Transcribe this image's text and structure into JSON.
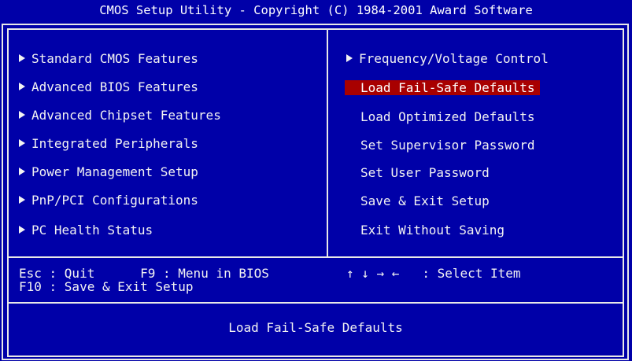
{
  "title": "CMOS Setup Utility - Copyright (C) 1984-2001 Award Software",
  "left_menu": [
    {
      "label": "Standard CMOS Features"
    },
    {
      "label": "Advanced BIOS Features"
    },
    {
      "label": "Advanced Chipset Features"
    },
    {
      "label": "Integrated Peripherals"
    },
    {
      "label": "Power Management Setup"
    },
    {
      "label": "PnP/PCI Configurations"
    },
    {
      "label": "PC Health Status"
    }
  ],
  "right_menu": [
    {
      "label": "Frequency/Voltage Control"
    },
    {
      "label": "Load Fail-Safe Defaults"
    },
    {
      "label": "Load Optimized Defaults"
    },
    {
      "label": "Set Supervisor Password"
    },
    {
      "label": "Set User Password"
    },
    {
      "label": "Save & Exit Setup"
    },
    {
      "label": "Exit Without Saving"
    }
  ],
  "help": {
    "line1_left": "Esc : Quit      F9 : Menu in BIOS",
    "line1_right": "↑ ↓ → ←   : Select Item",
    "line2": "F10 : Save & Exit Setup"
  },
  "status_text": "Load Fail-Safe Defaults",
  "colors": {
    "background": "#0000a8",
    "highlight": "#a80000",
    "text": "#f2f2f2"
  }
}
